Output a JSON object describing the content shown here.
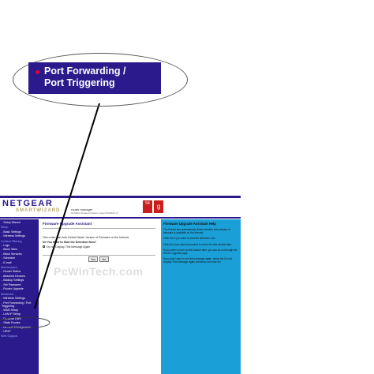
{
  "callout": {
    "label_line1": "Port Forwarding /",
    "label_line2": "Port Triggering"
  },
  "header": {
    "brand": "NETGEAR",
    "brand_sub": "SMARTWIZARD",
    "product": "router manager",
    "model": "54 Mbps Wireless Router model WGR614 v7",
    "badge_54": "54",
    "badge_g": "g"
  },
  "sidebar": {
    "items": [
      {
        "kind": "item",
        "label": "- Setup Wizard"
      },
      {
        "kind": "sec",
        "label": "Setup"
      },
      {
        "kind": "item",
        "label": "- Basic Settings"
      },
      {
        "kind": "item",
        "label": "- Wireless Settings"
      },
      {
        "kind": "sec",
        "label": "Content Filtering"
      },
      {
        "kind": "item",
        "label": "- Logs"
      },
      {
        "kind": "item",
        "label": "- Block Sites"
      },
      {
        "kind": "item",
        "label": "- Block Services"
      },
      {
        "kind": "item",
        "label": "- Schedule"
      },
      {
        "kind": "item",
        "label": "- E-mail"
      },
      {
        "kind": "sec",
        "label": "Maintenance"
      },
      {
        "kind": "item",
        "label": "- Router Status"
      },
      {
        "kind": "item",
        "label": "- Attached Devices"
      },
      {
        "kind": "item",
        "label": "- Backup Settings"
      },
      {
        "kind": "item",
        "label": "- Set Password"
      },
      {
        "kind": "item",
        "label": "- Router Upgrade"
      },
      {
        "kind": "sec",
        "label": "Advanced"
      },
      {
        "kind": "item",
        "label": "- Wireless Settings"
      },
      {
        "kind": "item",
        "label": "- Port Forwarding / Port Triggering",
        "multi": true
      },
      {
        "kind": "item",
        "label": "- WAN Setup"
      },
      {
        "kind": "item",
        "label": "- LAN IP Setup"
      },
      {
        "kind": "item",
        "label": "- Dynamic DNS"
      },
      {
        "kind": "item",
        "label": "- Static Routes"
      },
      {
        "kind": "item",
        "label": "- Remote Management"
      },
      {
        "kind": "item",
        "label": "- UPnP"
      },
      {
        "kind": "sec",
        "label": "Web Support"
      }
    ]
  },
  "main": {
    "title": "Firmware Upgrade Assistant",
    "line1": "This router can Auto Detect Newer Version of Firmware on the Internet.",
    "line2": "Do You Want to Start the Detection Now?",
    "checkbox_label": "Do not Display This Message Again",
    "yes_label": "Yes",
    "no_label": "No"
  },
  "help": {
    "title": "Firmware Upgrade Assistant Help",
    "p1": "The Router can automatically detect whether new version of firmware is available on the Internet.",
    "p2": "Click Yes if you want to start the detection now.",
    "p3": "Click No if you want to proceed to check for new version later.",
    "p4": "If you prefer to turn on this feature later, you can do so through the Router Upgrade page.",
    "p5": "If you don't want to see this message again, check the Do not Display This Message Again checkbox and click No."
  },
  "watermark": "PcWinTech.com"
}
